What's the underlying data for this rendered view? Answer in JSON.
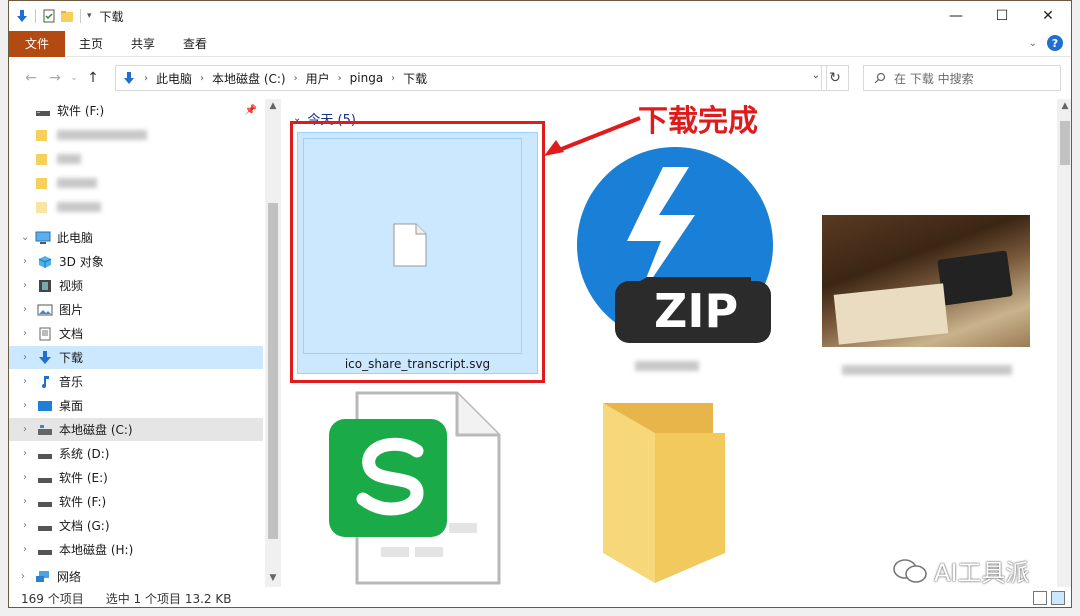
{
  "window": {
    "title": "下载",
    "controls": {
      "minimize": "—",
      "maximize": "☐",
      "close": "✕"
    }
  },
  "ribbon": {
    "tabs": [
      "文件",
      "主页",
      "共享",
      "查看"
    ],
    "help": "?"
  },
  "address": {
    "crumbs": [
      "此电脑",
      "本地磁盘 (C:)",
      "用户",
      "pinga",
      "下载"
    ],
    "search_placeholder": "在 下载 中搜索"
  },
  "nav": {
    "pinned_top": "软件 (F:)",
    "this_pc": "此电脑",
    "items": [
      {
        "label": "3D 对象",
        "icon": "3d-objects-icon"
      },
      {
        "label": "视频",
        "icon": "video-icon"
      },
      {
        "label": "图片",
        "icon": "pictures-icon"
      },
      {
        "label": "文档",
        "icon": "documents-icon"
      },
      {
        "label": "下载",
        "icon": "download-icon"
      },
      {
        "label": "音乐",
        "icon": "music-icon"
      },
      {
        "label": "桌面",
        "icon": "desktop-icon"
      },
      {
        "label": "本地磁盘 (C:)",
        "icon": "drive-icon"
      },
      {
        "label": "系统 (D:)",
        "icon": "drive-icon"
      },
      {
        "label": "软件 (E:)",
        "icon": "drive-icon"
      },
      {
        "label": "软件 (F:)",
        "icon": "drive-icon"
      },
      {
        "label": "文档 (G:)",
        "icon": "drive-icon"
      },
      {
        "label": "本地磁盘 (H:)",
        "icon": "drive-icon"
      }
    ],
    "network": "网络"
  },
  "content": {
    "group_header": "今天 (5)",
    "files": [
      {
        "name": "ico_share_transcript.svg",
        "selected": true
      },
      {
        "name": "ZIP"
      }
    ]
  },
  "status": {
    "count": "169 个项目",
    "selection": "选中 1 个项目  13.2 KB"
  },
  "annotation": {
    "text": "下载完成"
  },
  "watermark": {
    "text": "AI工具派"
  },
  "colors": {
    "file_tab": "#b34a12",
    "selection": "#cce8ff",
    "annotation": "#e01b1b",
    "zip_blue": "#1a7fd6",
    "sheet_green": "#1aab48"
  }
}
